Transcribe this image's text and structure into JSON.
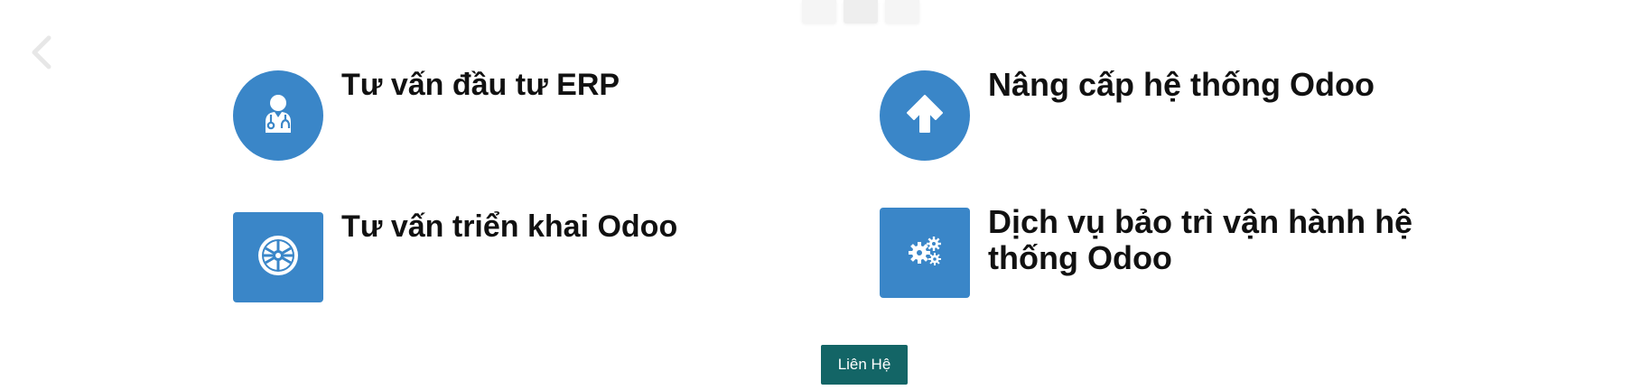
{
  "carousel": {
    "indicators": 3,
    "prev_icon": "chevron-left-icon"
  },
  "services": [
    {
      "title": "Tư vấn đầu tư ERP",
      "icon": "doctor-icon",
      "shape": "circle"
    },
    {
      "title": "Nâng cấp hệ thống Odoo",
      "icon": "arrow-up-icon",
      "shape": "circle"
    },
    {
      "title": "Tư vấn triển khai Odoo",
      "icon": "imperial-emblem-icon",
      "shape": "square"
    },
    {
      "title": "Dịch vụ bảo trì vận hành hệ thống Odoo",
      "icon": "gears-icon",
      "shape": "square"
    }
  ],
  "contact_button": {
    "label": "Liên Hệ"
  },
  "colors": {
    "icon_bg": "#3a86c8",
    "button_bg": "#136566",
    "text": "#111111"
  }
}
